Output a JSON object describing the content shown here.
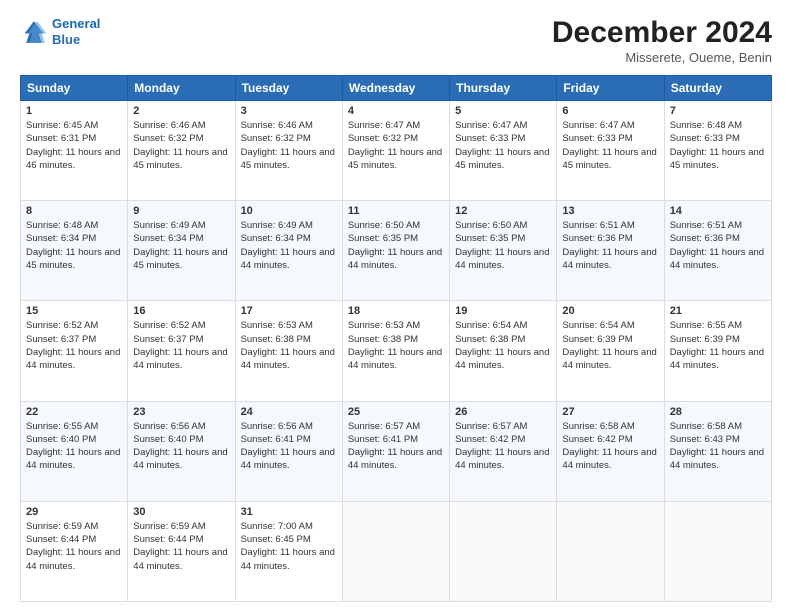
{
  "logo": {
    "line1": "General",
    "line2": "Blue"
  },
  "title": "December 2024",
  "subtitle": "Misserete, Oueme, Benin",
  "days_of_week": [
    "Sunday",
    "Monday",
    "Tuesday",
    "Wednesday",
    "Thursday",
    "Friday",
    "Saturday"
  ],
  "weeks": [
    [
      {
        "day": "1",
        "sunrise": "6:45 AM",
        "sunset": "6:31 PM",
        "daylight": "11 hours and 46 minutes."
      },
      {
        "day": "2",
        "sunrise": "6:46 AM",
        "sunset": "6:32 PM",
        "daylight": "11 hours and 45 minutes."
      },
      {
        "day": "3",
        "sunrise": "6:46 AM",
        "sunset": "6:32 PM",
        "daylight": "11 hours and 45 minutes."
      },
      {
        "day": "4",
        "sunrise": "6:47 AM",
        "sunset": "6:32 PM",
        "daylight": "11 hours and 45 minutes."
      },
      {
        "day": "5",
        "sunrise": "6:47 AM",
        "sunset": "6:33 PM",
        "daylight": "11 hours and 45 minutes."
      },
      {
        "day": "6",
        "sunrise": "6:47 AM",
        "sunset": "6:33 PM",
        "daylight": "11 hours and 45 minutes."
      },
      {
        "day": "7",
        "sunrise": "6:48 AM",
        "sunset": "6:33 PM",
        "daylight": "11 hours and 45 minutes."
      }
    ],
    [
      {
        "day": "8",
        "sunrise": "6:48 AM",
        "sunset": "6:34 PM",
        "daylight": "11 hours and 45 minutes."
      },
      {
        "day": "9",
        "sunrise": "6:49 AM",
        "sunset": "6:34 PM",
        "daylight": "11 hours and 45 minutes."
      },
      {
        "day": "10",
        "sunrise": "6:49 AM",
        "sunset": "6:34 PM",
        "daylight": "11 hours and 44 minutes."
      },
      {
        "day": "11",
        "sunrise": "6:50 AM",
        "sunset": "6:35 PM",
        "daylight": "11 hours and 44 minutes."
      },
      {
        "day": "12",
        "sunrise": "6:50 AM",
        "sunset": "6:35 PM",
        "daylight": "11 hours and 44 minutes."
      },
      {
        "day": "13",
        "sunrise": "6:51 AM",
        "sunset": "6:36 PM",
        "daylight": "11 hours and 44 minutes."
      },
      {
        "day": "14",
        "sunrise": "6:51 AM",
        "sunset": "6:36 PM",
        "daylight": "11 hours and 44 minutes."
      }
    ],
    [
      {
        "day": "15",
        "sunrise": "6:52 AM",
        "sunset": "6:37 PM",
        "daylight": "11 hours and 44 minutes."
      },
      {
        "day": "16",
        "sunrise": "6:52 AM",
        "sunset": "6:37 PM",
        "daylight": "11 hours and 44 minutes."
      },
      {
        "day": "17",
        "sunrise": "6:53 AM",
        "sunset": "6:38 PM",
        "daylight": "11 hours and 44 minutes."
      },
      {
        "day": "18",
        "sunrise": "6:53 AM",
        "sunset": "6:38 PM",
        "daylight": "11 hours and 44 minutes."
      },
      {
        "day": "19",
        "sunrise": "6:54 AM",
        "sunset": "6:38 PM",
        "daylight": "11 hours and 44 minutes."
      },
      {
        "day": "20",
        "sunrise": "6:54 AM",
        "sunset": "6:39 PM",
        "daylight": "11 hours and 44 minutes."
      },
      {
        "day": "21",
        "sunrise": "6:55 AM",
        "sunset": "6:39 PM",
        "daylight": "11 hours and 44 minutes."
      }
    ],
    [
      {
        "day": "22",
        "sunrise": "6:55 AM",
        "sunset": "6:40 PM",
        "daylight": "11 hours and 44 minutes."
      },
      {
        "day": "23",
        "sunrise": "6:56 AM",
        "sunset": "6:40 PM",
        "daylight": "11 hours and 44 minutes."
      },
      {
        "day": "24",
        "sunrise": "6:56 AM",
        "sunset": "6:41 PM",
        "daylight": "11 hours and 44 minutes."
      },
      {
        "day": "25",
        "sunrise": "6:57 AM",
        "sunset": "6:41 PM",
        "daylight": "11 hours and 44 minutes."
      },
      {
        "day": "26",
        "sunrise": "6:57 AM",
        "sunset": "6:42 PM",
        "daylight": "11 hours and 44 minutes."
      },
      {
        "day": "27",
        "sunrise": "6:58 AM",
        "sunset": "6:42 PM",
        "daylight": "11 hours and 44 minutes."
      },
      {
        "day": "28",
        "sunrise": "6:58 AM",
        "sunset": "6:43 PM",
        "daylight": "11 hours and 44 minutes."
      }
    ],
    [
      {
        "day": "29",
        "sunrise": "6:59 AM",
        "sunset": "6:44 PM",
        "daylight": "11 hours and 44 minutes."
      },
      {
        "day": "30",
        "sunrise": "6:59 AM",
        "sunset": "6:44 PM",
        "daylight": "11 hours and 44 minutes."
      },
      {
        "day": "31",
        "sunrise": "7:00 AM",
        "sunset": "6:45 PM",
        "daylight": "11 hours and 44 minutes."
      },
      null,
      null,
      null,
      null
    ]
  ]
}
